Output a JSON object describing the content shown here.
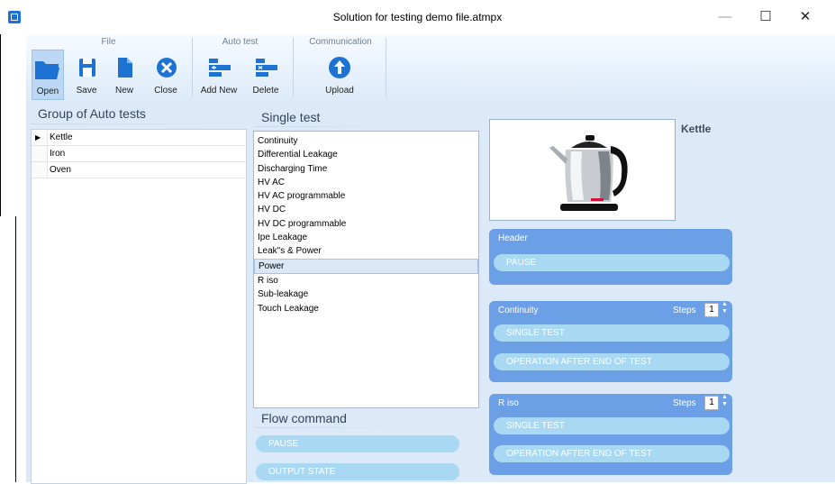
{
  "window": {
    "title": "Solution for testing demo file.atmpx",
    "minimize": "—",
    "maximize": "☐",
    "close": "✕"
  },
  "ribbon": {
    "groups": {
      "file": "File",
      "auto_test": "Auto test",
      "communication": "Communication"
    },
    "buttons": {
      "open": "Open",
      "save": "Save",
      "new": "New",
      "close": "Close",
      "add_new": "Add New",
      "delete": "Delete",
      "upload": "Upload"
    }
  },
  "groups_panel": {
    "title": "Group of Auto tests",
    "rows": [
      "Kettle",
      "Iron",
      "Oven"
    ],
    "selected_marker": "▶"
  },
  "single_test": {
    "title": "Single test",
    "items": [
      "Continuity",
      "Differential Leakage",
      "Discharging Time",
      "HV AC",
      "HV AC programmable",
      "HV DC",
      "HV DC programmable",
      "Ipe Leakage",
      "Leak\"s & Power",
      "Power",
      "R iso",
      "Sub-leakage",
      "Touch Leakage"
    ],
    "selected": "Power"
  },
  "flow_command": {
    "title": "Flow command",
    "items": [
      "PAUSE",
      "OUTPUT STATE"
    ]
  },
  "device": {
    "name": "Kettle"
  },
  "cards": {
    "header": {
      "title": "Header",
      "items": [
        "PAUSE"
      ]
    },
    "continuity": {
      "title": "Continuity",
      "steps_label": "Steps",
      "steps": "1",
      "items": [
        "SINGLE TEST",
        "OPERATION AFTER END OF TEST"
      ]
    },
    "riso": {
      "title": "R iso",
      "steps_label": "Steps",
      "steps": "1",
      "items": [
        "SINGLE TEST",
        "OPERATION AFTER END OF TEST"
      ]
    }
  },
  "colors": {
    "ribbon_bg": "#dceaf9",
    "panel_bg": "#dbe9f8",
    "card": "#6ca0e6",
    "pill": "#a9d8f3",
    "icon_blue": "#1e73d2"
  },
  "icons": [
    "folder-open-icon",
    "save-icon",
    "new-document-icon",
    "close-circle-icon",
    "add-new-icon",
    "delete-icon",
    "upload-icon",
    "kettle-image"
  ]
}
